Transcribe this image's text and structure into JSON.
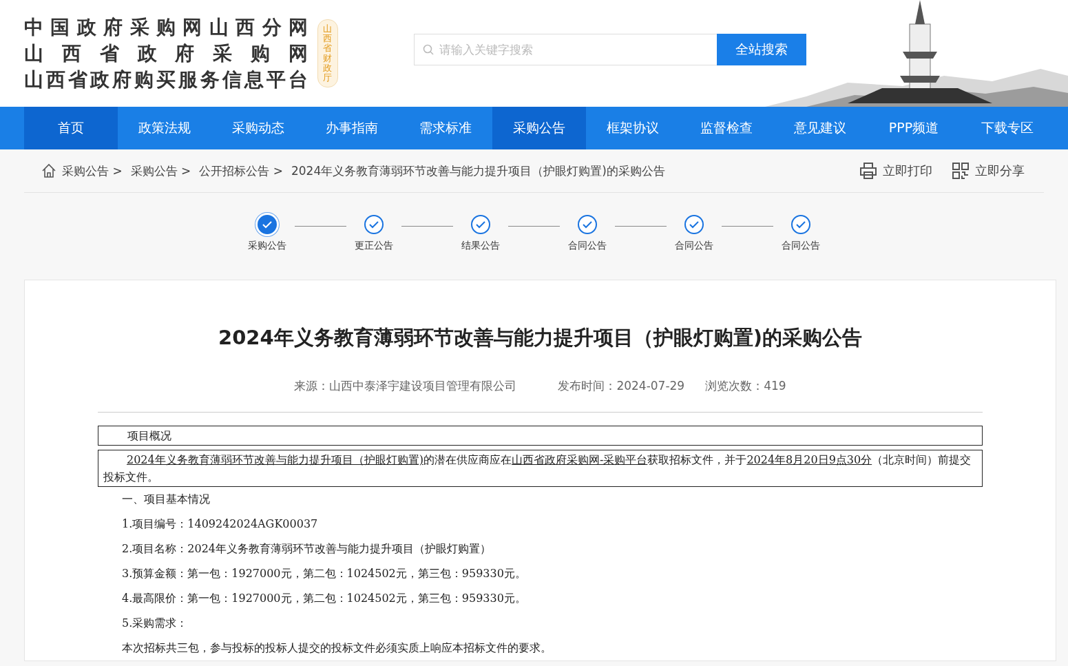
{
  "logo": {
    "lines": [
      "中国政府采购网山西分网",
      "山西省政府采购网",
      "山西省政府购买服务信息平台"
    ],
    "badge": "山西省财政厅"
  },
  "search": {
    "placeholder": "请输入关键字搜索",
    "button": "全站搜索"
  },
  "nav": [
    {
      "label": "首页",
      "selected": true
    },
    {
      "label": "政策法规",
      "selected": false
    },
    {
      "label": "采购动态",
      "selected": false
    },
    {
      "label": "办事指南",
      "selected": false
    },
    {
      "label": "需求标准",
      "selected": false
    },
    {
      "label": "采购公告",
      "selected": true
    },
    {
      "label": "框架协议",
      "selected": false
    },
    {
      "label": "监督检查",
      "selected": false
    },
    {
      "label": "意见建议",
      "selected": false
    },
    {
      "label": "PPP频道",
      "selected": false
    },
    {
      "label": "下载专区",
      "selected": false
    }
  ],
  "breadcrumb": [
    "采购公告 >",
    "采购公告 >",
    "公开招标公告 >",
    "2024年义务教育薄弱环节改善与能力提升项目（护眼灯购置)的采购公告"
  ],
  "actions": [
    {
      "kind": "print",
      "label": "立即打印"
    },
    {
      "kind": "share",
      "label": "立即分享"
    }
  ],
  "steps": [
    {
      "label": "采购公告",
      "selected": true
    },
    {
      "label": "更正公告",
      "selected": false
    },
    {
      "label": "结果公告",
      "selected": false
    },
    {
      "label": "合同公告",
      "selected": false
    },
    {
      "label": "合同公告",
      "selected": false
    },
    {
      "label": "合同公告",
      "selected": false
    }
  ],
  "article": {
    "title": "2024年义务教育薄弱环节改善与能力提升项目（护眼灯购置)的采购公告",
    "meta": [
      "来源：山西中泰泽宇建设项目管理有限公司",
      "发布时间：2024-07-29",
      "浏览次数：419"
    ],
    "overview_heading": "项目概况",
    "overview": [
      {
        "text": "2024年义务教育薄弱环节改善与能力提升项目（护眼灯购置)",
        "underlined": true
      },
      {
        "text": "的潜在供应商应在",
        "underlined": false
      },
      {
        "text": "山西省政府采购网-采购平台",
        "underlined": true
      },
      {
        "text": "获取招标文件，并于",
        "underlined": false
      },
      {
        "text": "2024年8月20日9点30分",
        "underlined": true
      },
      {
        "text": "（北京时间）前提交投标文件。",
        "underlined": false
      }
    ],
    "section_heading": "一、项目基本情况",
    "items": [
      "1.项目编号：1409242024AGK00037",
      "2.项目名称：2024年义务教育薄弱环节改善与能力提升项目（护眼灯购置）",
      "3.预算金额：第一包：1927000元，第二包：1024502元，第三包：959330元。",
      "4.最高限价：第一包：1927000元，第二包：1024502元，第三包：959330元。",
      "5.采购需求："
    ],
    "closing": "本次招标共三包，参与投标的投标人提交的投标文件必须实质上响应本招标文件的要求。"
  }
}
